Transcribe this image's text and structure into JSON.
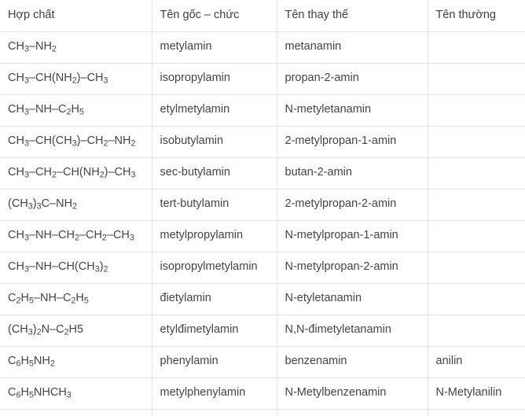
{
  "table": {
    "name": "bang-ten-goi-amin",
    "columns": [
      {
        "key": "compound",
        "label": "Hợp chất"
      },
      {
        "key": "radical",
        "label": "Tên gốc – chức"
      },
      {
        "key": "substitutive",
        "label": "Tên thay thế"
      },
      {
        "key": "common",
        "label": "Tên thường"
      }
    ],
    "rows": [
      {
        "compound": "CH3–NH2",
        "compound_html": "CH<sub>3</sub>–NH<sub>2</sub>",
        "radical": "metylamin",
        "substitutive": "metanamin",
        "common": ""
      },
      {
        "compound": "CH3–CH(NH2)–CH3",
        "compound_html": "CH<sub>3</sub>–CH(NH<sub>2</sub>)–CH<sub>3</sub>",
        "radical": "isopropylamin",
        "substitutive": "propan-2-amin",
        "common": ""
      },
      {
        "compound": "CH3–NH–C2H5",
        "compound_html": "CH<sub>3</sub>–NH–C<sub>2</sub>H<sub>5</sub>",
        "radical": "etylmetylamin",
        "substitutive": "N-metyletanamin",
        "common": ""
      },
      {
        "compound": "CH3–CH(CH3)–CH2–NH2",
        "compound_html": "CH<sub>3</sub>–CH(CH<sub>3</sub>)–CH<sub>2</sub>–NH<sub>2</sub>",
        "radical": "isobutylamin",
        "substitutive": "2-metylpropan-1-amin",
        "common": ""
      },
      {
        "compound": "CH3–CH2–CH(NH2)–CH3",
        "compound_html": "CH<sub>3</sub>–CH<sub>2</sub>–CH(NH<sub>2</sub>)–CH<sub>3</sub>",
        "radical": "sec-butylamin",
        "substitutive": "butan-2-amin",
        "common": ""
      },
      {
        "compound": "(CH3)3C–NH2",
        "compound_html": "(CH<sub>3</sub>)<sub>3</sub>C–NH<sub>2</sub>",
        "radical": "tert-butylamin",
        "substitutive": "2-metylpropan-2-amin",
        "common": ""
      },
      {
        "compound": "CH3–NH–CH2–CH2–CH3",
        "compound_html": "CH<sub>3</sub>–NH–CH<sub>2</sub>–CH<sub>2</sub>–CH<sub>3</sub>",
        "radical": "metylpropylamin",
        "substitutive": "N-metylpropan-1-amin",
        "common": ""
      },
      {
        "compound": "CH3–NH–CH(CH3)2",
        "compound_html": "CH<sub>3</sub>–NH–CH(CH<sub>3</sub>)<sub>2</sub>",
        "radical": "isopropylmetylamin",
        "substitutive": "N-metylpropan-2-amin",
        "common": ""
      },
      {
        "compound": "C2H5–NH–C2H5",
        "compound_html": "C<sub>2</sub>H<sub>5</sub>–NH–C<sub>2</sub>H<sub>5</sub>",
        "radical": "đietylamin",
        "substitutive": "N-etyletanamin",
        "common": ""
      },
      {
        "compound": "(CH3)2N–C2H5",
        "compound_html": "(CH<sub>3</sub>)<sub>2</sub>N–C<sub>2</sub>H5",
        "radical": "etylđimetylamin",
        "substitutive": "N,N-đimetyletanamin",
        "common": ""
      },
      {
        "compound": "C6H5NH2",
        "compound_html": "C<sub>6</sub>H<sub>5</sub>NH<sub>2</sub>",
        "radical": "phenylamin",
        "substitutive": "benzenamin",
        "common": "anilin"
      },
      {
        "compound": "C6H5NHCH3",
        "compound_html": "C<sub>6</sub>H<sub>5</sub>NHCH<sub>3</sub>",
        "radical": "metylphenylamin",
        "substitutive": "N-Metylbenzenamin",
        "common": "N-Metylanilin"
      }
    ],
    "has_clipped_trailing_row": true
  },
  "style": {
    "border_color": "#e2e2e2",
    "text_color": "#444444",
    "background": "#ffffff"
  }
}
